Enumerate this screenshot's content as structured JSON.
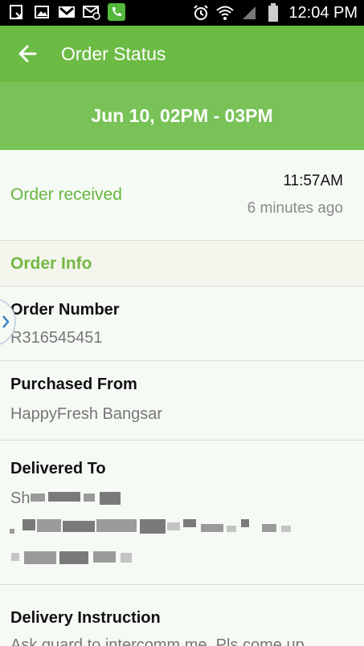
{
  "status_bar": {
    "time": "12:04 PM",
    "left_icons": [
      "notification-icon",
      "image-icon",
      "gmail-icon",
      "email-icon",
      "phone-icon"
    ],
    "right_icons": [
      "alarm-icon",
      "wifi-icon",
      "signal-icon",
      "battery-icon"
    ]
  },
  "appbar": {
    "title": "Order Status"
  },
  "slot": {
    "text": "Jun 10, 02PM - 03PM"
  },
  "status": {
    "label": "Order received",
    "time": "11:57AM",
    "ago": "6 minutes ago"
  },
  "order_info": {
    "title": "Order Info",
    "order_number_label": "Order Number",
    "order_number": "R316545451",
    "purchased_from_label": "Purchased From",
    "purchased_from": "HappyFresh Bangsar",
    "delivered_to_label": "Delivered To",
    "delivered_to_partial": "Sh",
    "delivery_instruction_label": "Delivery Instruction",
    "delivery_instruction": "Ask guard to intercomm me. Pls come up"
  },
  "colors": {
    "green_dark": "#6cbb45",
    "green_banner": "#78c257",
    "green_text": "#67b540"
  }
}
